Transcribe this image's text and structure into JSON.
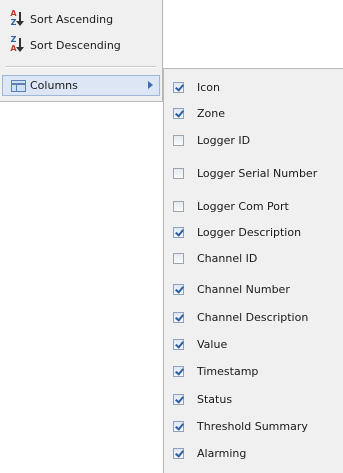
{
  "menu": {
    "sort_ascending": "Sort Ascending",
    "sort_descending": "Sort Descending",
    "columns": "Columns",
    "sort_ascending_icon": "sort-ascending-icon",
    "sort_descending_icon": "sort-descending-icon",
    "columns_icon": "columns-icon"
  },
  "columns_submenu": [
    {
      "label": "Icon",
      "checked": true
    },
    {
      "label": "Zone",
      "checked": true
    },
    {
      "label": "Logger ID",
      "checked": false
    },
    {
      "label": "Logger Serial Number",
      "checked": false
    },
    {
      "label": "Logger Com Port",
      "checked": false
    },
    {
      "label": "Logger Description",
      "checked": true
    },
    {
      "label": "Channel ID",
      "checked": false
    },
    {
      "label": "Channel Number",
      "checked": true
    },
    {
      "label": "Channel Description",
      "checked": true
    },
    {
      "label": "Value",
      "checked": true
    },
    {
      "label": "Timestamp",
      "checked": true
    },
    {
      "label": "Status",
      "checked": true
    },
    {
      "label": "Threshold Summary",
      "checked": true
    },
    {
      "label": "Alarming",
      "checked": true
    }
  ],
  "colors": {
    "menu_bg": "#f0f0f0",
    "highlight_bg": "#dce6f4",
    "highlight_border": "#9fb6d8",
    "submenu_arrow": "#3a6fb8",
    "check_mark": "#2f5f9f"
  }
}
